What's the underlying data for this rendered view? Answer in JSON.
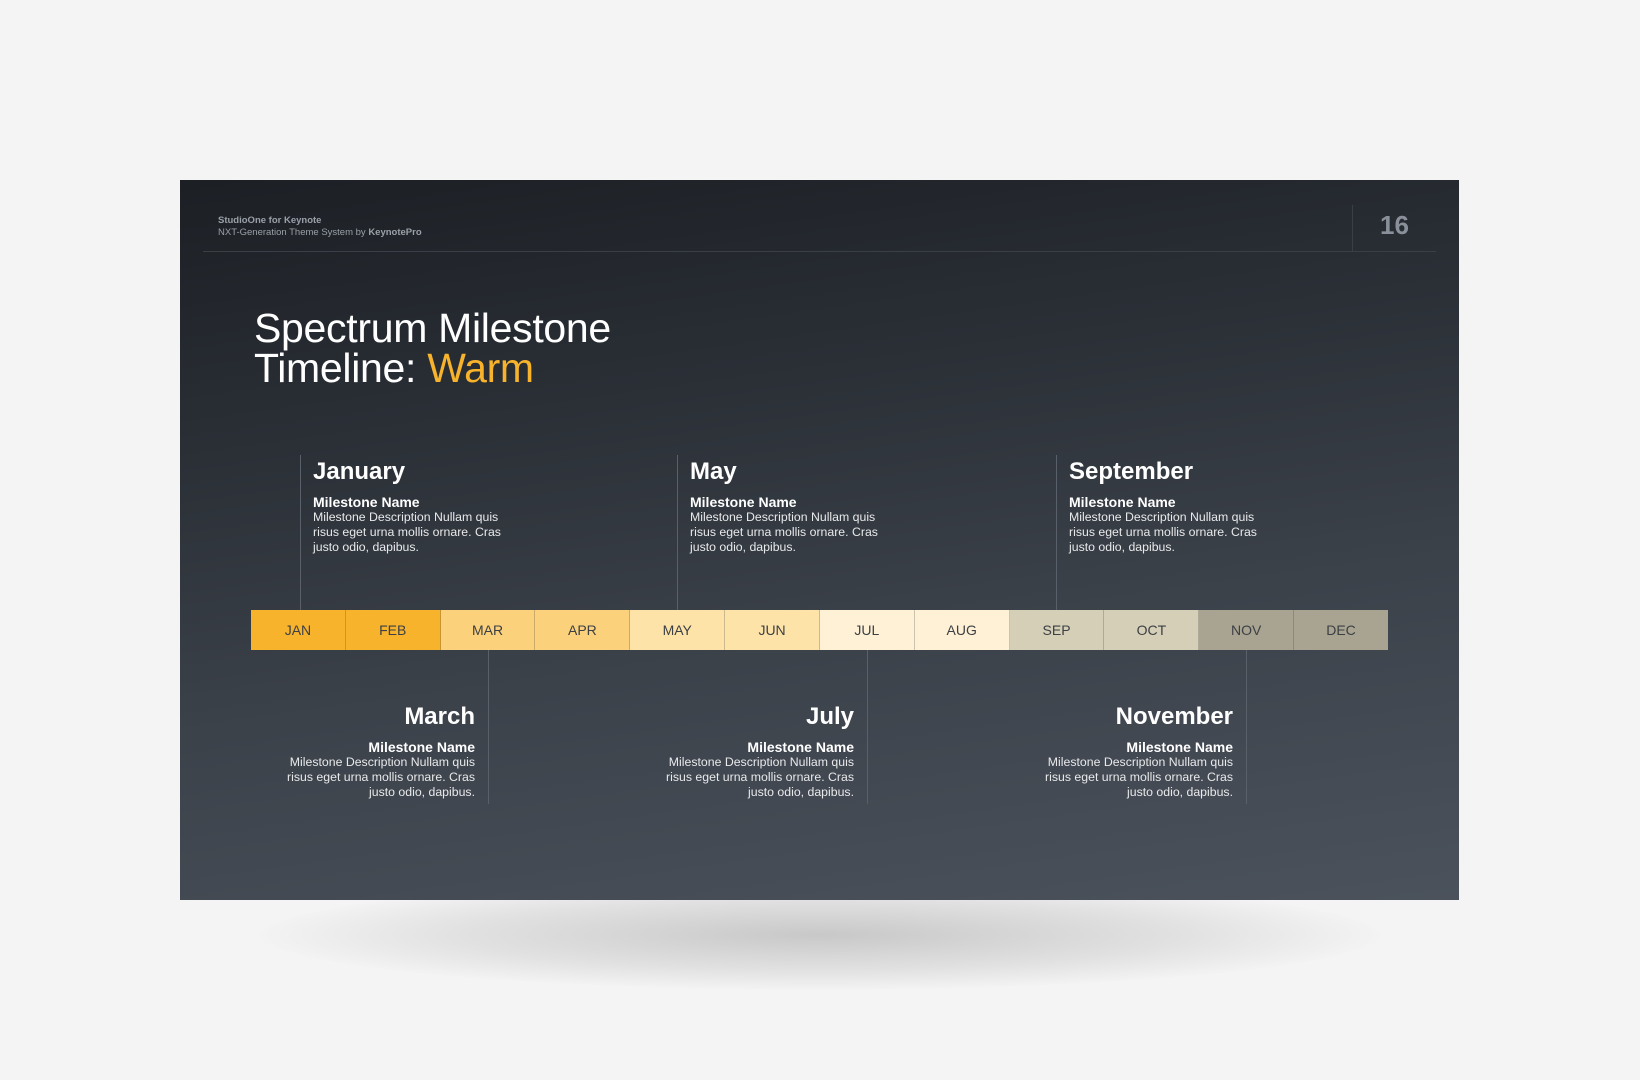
{
  "header": {
    "brand_line1": "StudioOne for Keynote",
    "brand_line2_prefix": "NXT-Generation Theme System by ",
    "brand_line2_bold": "KeynotePro",
    "page_number": "16"
  },
  "title": {
    "line1": "Spectrum Milestone",
    "line2_prefix": "Timeline: ",
    "line2_accent": "Warm",
    "accent_color": "#f7b32b"
  },
  "timeline": {
    "months": [
      {
        "label": "JAN",
        "color": "#f7b32b"
      },
      {
        "label": "FEB",
        "color": "#f7b32b"
      },
      {
        "label": "MAR",
        "color": "#fbd17c"
      },
      {
        "label": "APR",
        "color": "#fbd17c"
      },
      {
        "label": "MAY",
        "color": "#fde3a8"
      },
      {
        "label": "JUN",
        "color": "#fde3a8"
      },
      {
        "label": "JUL",
        "color": "#fef1d6"
      },
      {
        "label": "AUG",
        "color": "#fef1d6"
      },
      {
        "label": "SEP",
        "color": "#d5cfb8"
      },
      {
        "label": "OCT",
        "color": "#d5cfb8"
      },
      {
        "label": "NOV",
        "color": "#a8a491"
      },
      {
        "label": "DEC",
        "color": "#a8a491"
      }
    ]
  },
  "milestones": {
    "top": [
      {
        "month": "January",
        "name": "Milestone Name",
        "desc": "Milestone Description Nullam quis risus eget urna mollis ornare. Cras justo odio, dapibus."
      },
      {
        "month": "May",
        "name": "Milestone Name",
        "desc": "Milestone Description Nullam quis risus eget urna mollis ornare. Cras justo odio, dapibus."
      },
      {
        "month": "September",
        "name": "Milestone Name",
        "desc": "Milestone Description Nullam quis risus eget urna mollis ornare. Cras justo odio, dapibus."
      }
    ],
    "bottom": [
      {
        "month": "March",
        "name": "Milestone Name",
        "desc": "Milestone Description Nullam quis risus eget urna mollis ornare. Cras justo odio, dapibus."
      },
      {
        "month": "July",
        "name": "Milestone Name",
        "desc": "Milestone Description Nullam quis risus eget urna mollis ornare. Cras justo odio, dapibus."
      },
      {
        "month": "November",
        "name": "Milestone Name",
        "desc": "Milestone Description Nullam quis risus eget urna mollis ornare. Cras justo odio, dapibus."
      }
    ]
  }
}
